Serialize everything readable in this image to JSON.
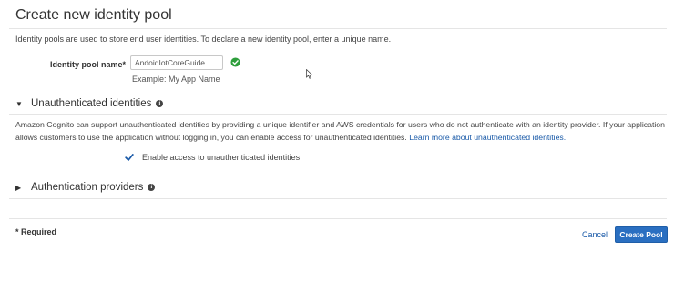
{
  "page": {
    "title": "Create new identity pool",
    "intro": "Identity pools are used to store end user identities. To declare a new identity pool, enter a unique name."
  },
  "pool_name_field": {
    "label": "Identity pool name*",
    "value": "AndoidIotCoreGuide",
    "example": "Example: My App Name",
    "status_icon": "check-circle-icon",
    "status_color": "#2e9e3c"
  },
  "unauthenticated_section": {
    "header": "Unauthenticated identities",
    "expanded": true,
    "description": "Amazon Cognito can support unauthenticated identities by providing a unique identifier and AWS credentials for users who do not authenticate with an identity provider. If your application allows customers to use the application without logging in, you can enable access for unauthenticated identities.",
    "learn_more_link": "Learn more about unauthenticated identities.",
    "checkbox_label": "Enable access to unauthenticated identities",
    "checkbox_checked": true
  },
  "auth_providers_section": {
    "header": "Authentication providers",
    "expanded": false
  },
  "footer": {
    "required_note": "* Required",
    "cancel_label": "Cancel",
    "create_label": "Create Pool",
    "primary_color": "#2a6fc1",
    "link_color": "#1a5aa8"
  }
}
